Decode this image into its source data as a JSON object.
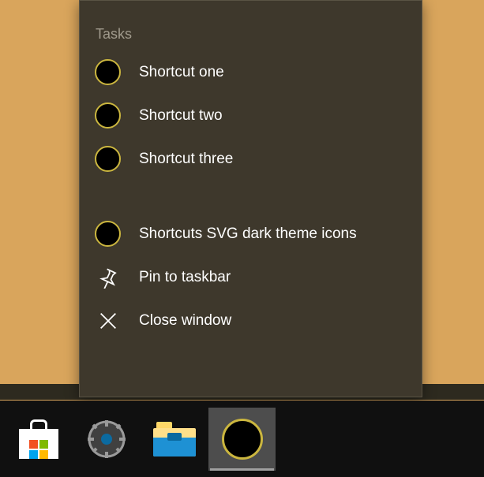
{
  "jumplist": {
    "header": "Tasks",
    "tasks": [
      {
        "label": "Shortcut one"
      },
      {
        "label": "Shortcut two"
      },
      {
        "label": "Shortcut three"
      }
    ],
    "app_item": {
      "label": "Shortcuts SVG dark theme icons"
    },
    "pin": {
      "label": "Pin to taskbar"
    },
    "close": {
      "label": "Close window"
    }
  },
  "taskbar": {
    "items": [
      {
        "name": "microsoft-store"
      },
      {
        "name": "settings"
      },
      {
        "name": "file-explorer"
      },
      {
        "name": "shortcuts-app",
        "active": true
      }
    ]
  }
}
